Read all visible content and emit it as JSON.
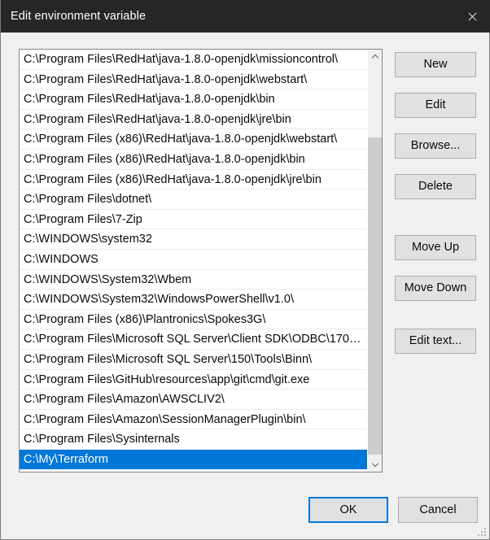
{
  "window": {
    "title": "Edit environment variable",
    "close_icon": "close-icon"
  },
  "list": {
    "selected_index": 20,
    "items": [
      "C:\\Program Files\\RedHat\\java-1.8.0-openjdk\\missioncontrol\\",
      "C:\\Program Files\\RedHat\\java-1.8.0-openjdk\\webstart\\",
      "C:\\Program Files\\RedHat\\java-1.8.0-openjdk\\bin",
      "C:\\Program Files\\RedHat\\java-1.8.0-openjdk\\jre\\bin",
      "C:\\Program Files (x86)\\RedHat\\java-1.8.0-openjdk\\webstart\\",
      "C:\\Program Files (x86)\\RedHat\\java-1.8.0-openjdk\\bin",
      "C:\\Program Files (x86)\\RedHat\\java-1.8.0-openjdk\\jre\\bin",
      "C:\\Program Files\\dotnet\\",
      "C:\\Program Files\\7-Zip",
      "C:\\WINDOWS\\system32",
      "C:\\WINDOWS",
      "C:\\WINDOWS\\System32\\Wbem",
      "C:\\WINDOWS\\System32\\WindowsPowerShell\\v1.0\\",
      "C:\\Program Files (x86)\\Plantronics\\Spokes3G\\",
      "C:\\Program Files\\Microsoft SQL Server\\Client SDK\\ODBC\\170…",
      "C:\\Program Files\\Microsoft SQL Server\\150\\Tools\\Binn\\",
      "C:\\Program Files\\GitHub\\resources\\app\\git\\cmd\\git.exe",
      "C:\\Program Files\\Amazon\\AWSCLIV2\\",
      "C:\\Program Files\\Amazon\\SessionManagerPlugin\\bin\\",
      "C:\\Program Files\\Sysinternals",
      "C:\\My\\Terraform"
    ]
  },
  "scrollbar": {
    "up_icon": "chevron-up-icon",
    "down_icon": "chevron-down-icon"
  },
  "side_buttons": {
    "new": "New",
    "edit": "Edit",
    "browse": "Browse...",
    "delete": "Delete",
    "move_up": "Move Up",
    "move_down": "Move Down",
    "edit_text": "Edit text..."
  },
  "bottom_buttons": {
    "ok": "OK",
    "cancel": "Cancel"
  },
  "colors": {
    "titlebar_bg": "#262626",
    "dialog_bg": "#f0f0f0",
    "selection_blue": "#0078d7",
    "button_face": "#e1e1e1",
    "scroll_thumb": "#cdcdcd"
  }
}
